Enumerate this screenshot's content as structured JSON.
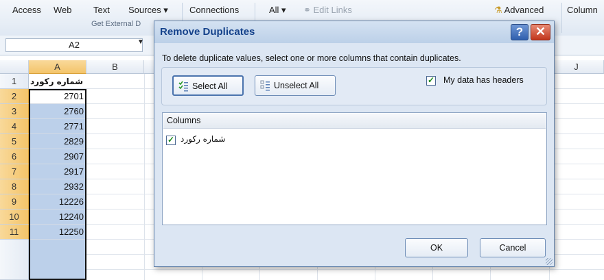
{
  "ribbon": {
    "items": [
      "Access",
      "Web",
      "Text",
      "Sources ▾",
      "Connections",
      "All ▾",
      "Edit Links",
      "Advanced",
      "Column"
    ],
    "group_label": "Get External D"
  },
  "formula_bar": {
    "name_box": "A2"
  },
  "grid": {
    "columns": [
      "A",
      "B",
      "J"
    ],
    "row_numbers": [
      "1",
      "2",
      "3",
      "4",
      "5",
      "6",
      "7",
      "8",
      "9",
      "10",
      "11"
    ],
    "header_cell": "شماره رکورد",
    "values": [
      "2701",
      "2760",
      "2771",
      "2829",
      "2907",
      "2917",
      "2932",
      "12226",
      "12240",
      "12250"
    ]
  },
  "dialog": {
    "title": "Remove Duplicates",
    "help_glyph": "?",
    "close_glyph": "✕",
    "instruction": "To delete duplicate values, select one or more columns that contain duplicates.",
    "select_all": "Select All",
    "unselect_all": "Unselect All",
    "headers_checkbox": "My data has headers",
    "headers_checked": true,
    "columns_header": "Columns",
    "column_items": [
      {
        "label": "شماره رکورد",
        "checked": true
      }
    ],
    "ok": "OK",
    "cancel": "Cancel"
  },
  "colors": {
    "selection": "#bcd0ea",
    "header_selected": "#f3c46a",
    "dialog_bg": "#dce6f3",
    "title_text": "#15428b",
    "close_red": "#c2361c"
  },
  "icons": [
    "checklist-icon",
    "unchecklist-icon",
    "checkmark-icon",
    "dropdown-arrow-icon",
    "resize-grip-icon"
  ]
}
